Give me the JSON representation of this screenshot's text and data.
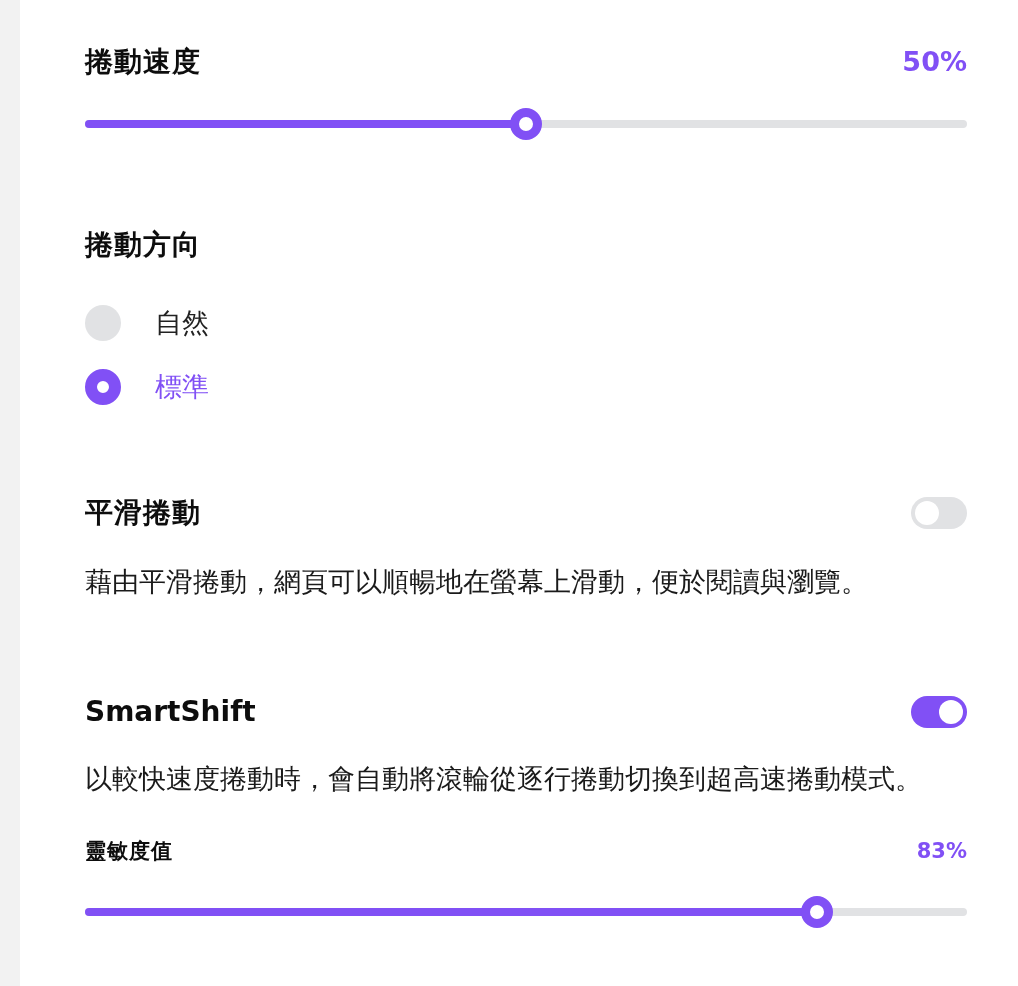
{
  "scroll_speed": {
    "label": "捲動速度",
    "reading": "50%",
    "level": 0.5
  },
  "scroll_direction": {
    "label": "捲動方向",
    "options": [
      {
        "label": "自然",
        "selected": false
      },
      {
        "label": "標準",
        "selected": true
      }
    ]
  },
  "smooth_scrolling": {
    "label": "平滑捲動",
    "on": false,
    "description": "藉由平滑捲動，網頁可以順暢地在螢幕上滑動，便於閱讀與瀏覽。"
  },
  "smartshift": {
    "label": "SmartShift",
    "on": true,
    "description": "以較快速度捲動時，會自動將滾輪從逐行捲動切換到超高速捲動模式。",
    "sensitivity": {
      "label": "靈敏度值",
      "reading": "83%",
      "level": 0.83
    }
  }
}
